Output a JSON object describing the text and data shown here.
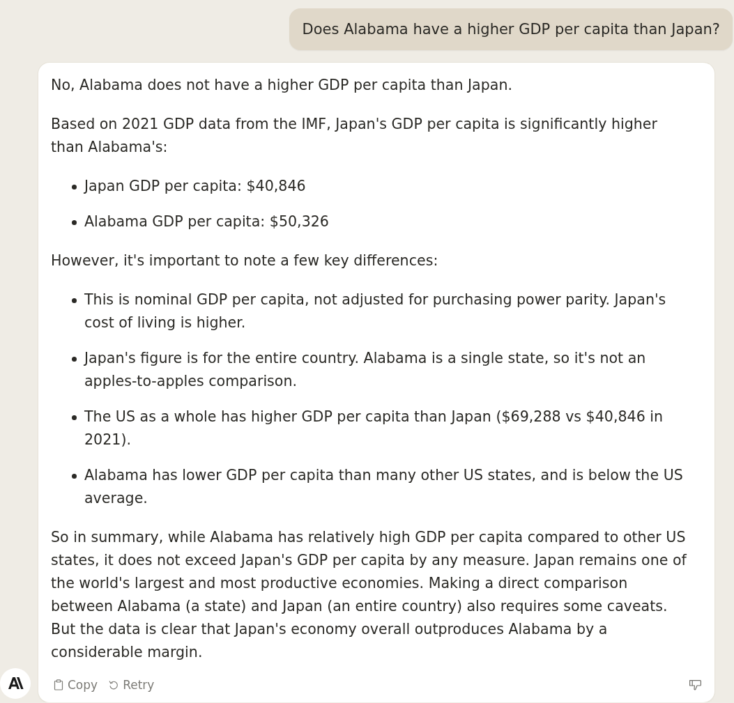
{
  "user_message": {
    "text": "Does Alabama have a higher GDP per capita than Japan?"
  },
  "response": {
    "blocks": [
      {
        "kind": "paragraph",
        "text": "No, Alabama does not have a higher GDP per capita than Japan."
      },
      {
        "kind": "paragraph",
        "text": "Based on 2021 GDP data from the IMF, Japan's GDP per capita is significantly higher than Alabama's:"
      },
      {
        "kind": "list",
        "items": [
          "Japan GDP per capita: $40,846",
          "Alabama GDP per capita: $50,326"
        ]
      },
      {
        "kind": "paragraph",
        "text": "However, it's important to note a few key differences:"
      },
      {
        "kind": "list",
        "items": [
          "This is nominal GDP per capita, not adjusted for purchasing power parity. Japan's cost of living is higher.",
          "Japan's figure is for the entire country. Alabama is a single state, so it's not an apples-to-apples comparison.",
          "The US as a whole has higher GDP per capita than Japan ($69,288 vs $40,846 in 2021).",
          "Alabama has lower GDP per capita than many other US states, and is below the US average."
        ]
      },
      {
        "kind": "paragraph",
        "text": "So in summary, while Alabama has relatively high GDP per capita compared to other US states, it does not exceed Japan's GDP per capita by any measure. Japan remains one of the world's largest and most productive economies. Making a direct comparison between Alabama (a state) and Japan (an entire country) also requires some caveats. But the data is clear that Japan's economy overall outproduces Alabama by a considerable margin."
      }
    ],
    "actions": [
      {
        "kind": "copy",
        "label": "Copy"
      },
      {
        "kind": "retry",
        "label": "Retry"
      }
    ]
  }
}
